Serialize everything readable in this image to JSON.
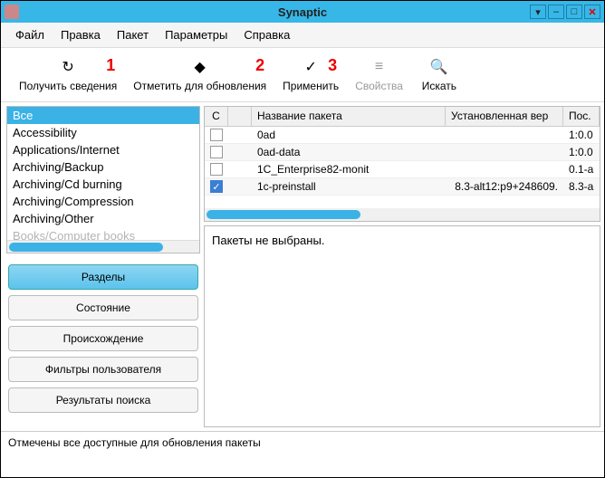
{
  "window": {
    "title": "Synaptic"
  },
  "menu": {
    "file": "Файл",
    "edit": "Правка",
    "packageMenu": "Пакет",
    "settings": "Параметры",
    "help": "Справка"
  },
  "toolbar": {
    "refresh": "Получить сведения",
    "markUpgrades": "Отметить для обновления",
    "apply": "Применить",
    "properties": "Свойства",
    "search": "Искать",
    "ann1": "1",
    "ann2": "2",
    "ann3": "3"
  },
  "categories": {
    "items": [
      "Все",
      "Accessibility",
      "Applications/Internet",
      "Archiving/Backup",
      "Archiving/Cd burning",
      "Archiving/Compression",
      "Archiving/Other",
      "Books/Computer books"
    ],
    "selectedIndex": 0
  },
  "selectors": {
    "sections": "Разделы",
    "status": "Состояние",
    "origin": "Происхождение",
    "customFilters": "Фильтры пользователя",
    "searchResults": "Результаты поиска"
  },
  "table": {
    "header": {
      "status": "С",
      "name": "Название пакета",
      "installed": "Установленная вер",
      "available": "Пос."
    },
    "rows": [
      {
        "checked": false,
        "name": "0ad",
        "installed": "",
        "available": "1:0.0"
      },
      {
        "checked": false,
        "name": "0ad-data",
        "installed": "",
        "available": "1:0.0"
      },
      {
        "checked": false,
        "name": "1C_Enterprise82-monit",
        "installed": "",
        "available": "0.1-a"
      },
      {
        "checked": true,
        "name": "1c-preinstall",
        "installed": "8.3-alt12:p9+248609.",
        "available": "8.3-a"
      }
    ]
  },
  "details": {
    "message": "Пакеты не выбраны."
  },
  "statusbar": {
    "text": "Отмечены все доступные для обновления пакеты"
  }
}
